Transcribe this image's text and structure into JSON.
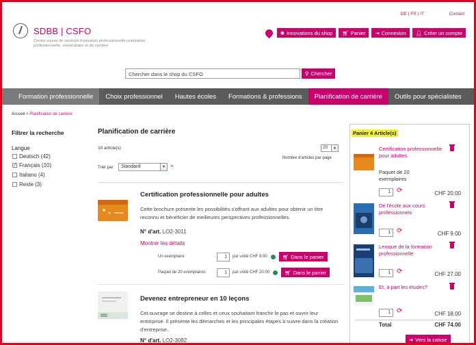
{
  "header": {
    "brand": "SDBB | CSFO",
    "tagline": "Centre suisse de services Formation professionnelle orientation professionnelle, universitaire et de carrière",
    "languages": "DE | FR | IT",
    "contact": "Contact",
    "buttons": [
      "Innovations du shop",
      "Panier",
      "Connexion",
      "Créer un compte"
    ]
  },
  "search": {
    "placeholder": "Chercher dans le shop du CSFO",
    "button": "Chercher"
  },
  "nav": [
    "Formation professionnelle",
    "Choix professionnel",
    "Hautes écoles",
    "Formations & professions",
    "Planification de carrière",
    "Outils pour spécialistes"
  ],
  "breadcrumb": {
    "home": "Accueil >",
    "current": "Planification de carrière"
  },
  "filter": {
    "title": "Filtrer la recherche",
    "group": "Langue",
    "items": [
      {
        "label": "Deutsch (42)",
        "checked": false
      },
      {
        "label": "Français (10)",
        "checked": true
      },
      {
        "label": "Italiano (4)",
        "checked": false
      },
      {
        "label": "Reste (3)",
        "checked": false
      }
    ]
  },
  "main": {
    "title": "Planification de carrière",
    "count": "10 article(s)",
    "per_page_value": "20",
    "per_page_label": "Nombre d'articles par page",
    "sort_label": "Trier par",
    "sort_value": "Standard"
  },
  "products": [
    {
      "title": "Certification professionnelle pour adultes",
      "desc": "Cette brochure présente les possibilités s'offrant aux adultes pour obtenir un titre reconnu et bénéficier de meilleures perspectives professionnelles.",
      "art_label": "N° d'art.",
      "art_no": "LO2-3011",
      "details": "Montrer les détails",
      "options": [
        {
          "label": "Un exemplaire",
          "qty": "1",
          "price": "par unité CHF 8.00",
          "button": "Dans le panier"
        },
        {
          "label": "Paquet de 20 exemplaires",
          "qty": "1",
          "price": "par unité CHF 20.00",
          "button": "Dans le panier"
        }
      ]
    },
    {
      "title": "Devenez entrepreneur en 10 leçons",
      "desc": "Cet ouvrage se destine à celles et ceux souhaitant franchir le pas et ouvrir leur entreprise. Il présente les démarches et les principales étapes à suivre dans la création d'entreprise.",
      "art_label": "N° d'art.",
      "art_no": "LO2-3082"
    }
  ],
  "cart": {
    "title": "Panier 4 Article(s)",
    "items": [
      {
        "title": "Certification professionnelle pour adultes",
        "note": "Paquet de 20 exemplaires",
        "qty": "1",
        "price": "CHF 20.00"
      },
      {
        "title": "De l'école aux cours professionnels",
        "qty": "1",
        "price": "CHF 9.00"
      },
      {
        "title": "Lexique de la formation professionnelle",
        "qty": "1",
        "price": "CHF 27.00"
      },
      {
        "title": "Et, à part les études?",
        "qty": "1",
        "price": "CHF 18.00"
      }
    ],
    "total_label": "Total",
    "total_value": "CHF 74.00",
    "checkout": "Vers la caisse"
  }
}
